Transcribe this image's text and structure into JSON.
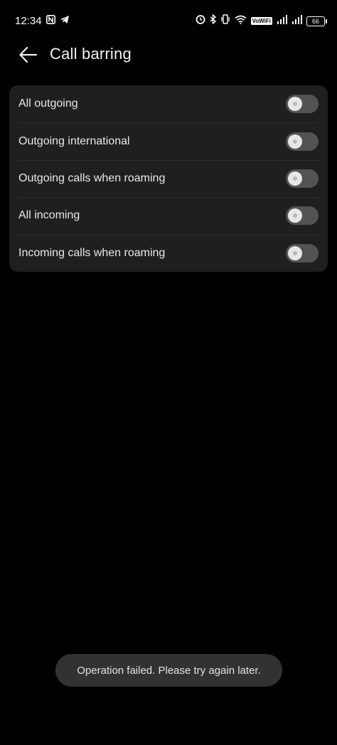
{
  "status_bar": {
    "time": "12:34",
    "vowifi": "VoWiFi",
    "battery": "66",
    "icons_left": [
      "nfc-icon",
      "telegram-icon"
    ],
    "icons_right": [
      "alarm-icon",
      "bluetooth-icon",
      "vibrate-icon",
      "wifi-icon",
      "vowifi-icon",
      "signal-icon",
      "signal-icon",
      "battery-icon"
    ]
  },
  "header": {
    "title": "Call barring",
    "back_icon": "arrow-left-icon"
  },
  "settings": {
    "items": [
      {
        "label": "All outgoing",
        "enabled": false
      },
      {
        "label": "Outgoing international",
        "enabled": false
      },
      {
        "label": "Outgoing calls when roaming",
        "enabled": false
      },
      {
        "label": "All incoming",
        "enabled": false
      },
      {
        "label": "Incoming calls when roaming",
        "enabled": false
      }
    ]
  },
  "toast": {
    "message": "Operation failed. Please try again later."
  },
  "colors": {
    "background": "#000000",
    "card": "#1f1f21",
    "switch_track": "#535356",
    "switch_knob": "#e7e7e7",
    "toast_bg": "#323234"
  }
}
